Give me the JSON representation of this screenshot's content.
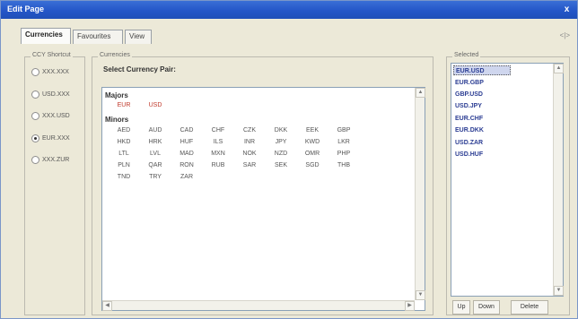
{
  "window": {
    "title": "Edit Page",
    "close_glyph": "x"
  },
  "tabs": [
    {
      "label": "Currencies",
      "active": true
    },
    {
      "label": "Favourites",
      "active": false
    },
    {
      "label": "View",
      "active": false
    }
  ],
  "tab_scroll_glyph": "<|>",
  "shortcut_panel": {
    "label": "CCY Shortcut",
    "options": [
      {
        "label": "XXX.XXX",
        "checked": false
      },
      {
        "label": "USD.XXX",
        "checked": false
      },
      {
        "label": "XXX.USD",
        "checked": false
      },
      {
        "label": "EUR.XXX",
        "checked": true
      },
      {
        "label": "XXX.ZUR",
        "checked": false
      }
    ]
  },
  "currencies_panel": {
    "label": "Currencies",
    "select_label": "Select Currency Pair:",
    "majors_label": "Majors",
    "majors": [
      "EUR",
      "USD"
    ],
    "minors_label": "Minors",
    "minors": [
      [
        "AED",
        "AUD",
        "CAD",
        "CHF",
        "CZK",
        "DKK",
        "EEK",
        "GBP"
      ],
      [
        "HKD",
        "HRK",
        "HUF",
        "ILS",
        "INR",
        "JPY",
        "KWD",
        "LKR"
      ],
      [
        "LTL",
        "LVL",
        "MAD",
        "MXN",
        "NOK",
        "NZD",
        "OMR",
        "PHP"
      ],
      [
        "PLN",
        "QAR",
        "RON",
        "RUB",
        "SAR",
        "SEK",
        "SGD",
        "THB"
      ],
      [
        "TND",
        "TRY",
        "ZAR"
      ]
    ]
  },
  "selected_panel": {
    "label": "Selected",
    "items": [
      "EUR.USD",
      "EUR.GBP",
      "GBP.USD",
      "USD.JPY",
      "EUR.CHF",
      "EUR.DKK",
      "USD.ZAR",
      "USD.HUF"
    ],
    "highlighted_index": 0
  },
  "buttons": {
    "up": "Up",
    "down": "Down",
    "delete": "Delete"
  },
  "icons": {
    "scroll_up": "up-arrow-icon",
    "scroll_down": "down-arrow-icon",
    "scroll_left": "left-arrow-icon",
    "scroll_right": "right-arrow-icon"
  }
}
